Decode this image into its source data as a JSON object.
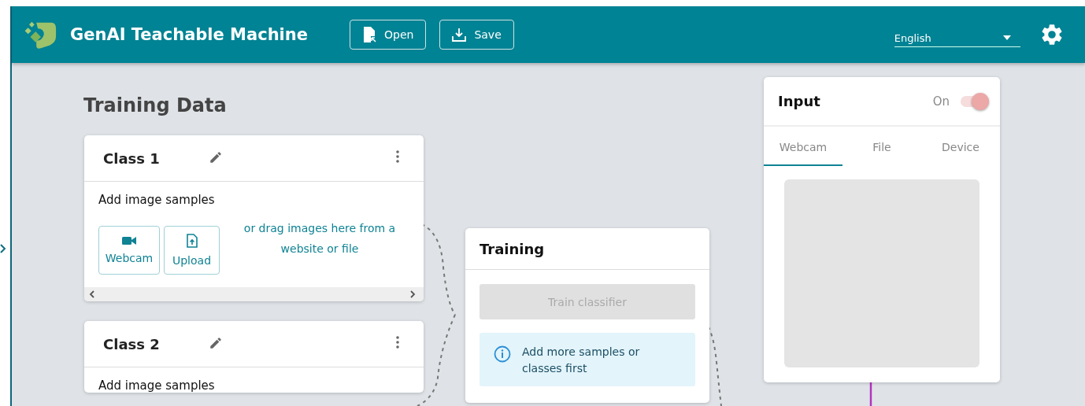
{
  "header": {
    "title": "GenAI Teachable Machine",
    "buttons": [
      {
        "kind": "open",
        "label": "Open"
      },
      {
        "kind": "save",
        "label": "Save"
      }
    ],
    "language": "English"
  },
  "section_title": "Training Data",
  "classes": [
    {
      "name": "Class 1",
      "prompt": "Add image samples",
      "sources": [
        {
          "kind": "webcam",
          "label": "Webcam"
        },
        {
          "kind": "upload",
          "label": "Upload"
        }
      ],
      "drag_hint": "or drag images here from a website or file"
    },
    {
      "name": "Class 2",
      "prompt": "Add image samples"
    }
  ],
  "training": {
    "title": "Training",
    "button": {
      "label": "Train classifier",
      "disabled": true
    },
    "info": "Add more samples or classes first"
  },
  "input": {
    "title": "Input",
    "toggle": {
      "label": "On",
      "on": true
    },
    "tabs": [
      {
        "label": "Webcam",
        "selected": true
      },
      {
        "label": "File",
        "selected": false
      },
      {
        "label": "Device",
        "selected": false
      }
    ]
  }
}
